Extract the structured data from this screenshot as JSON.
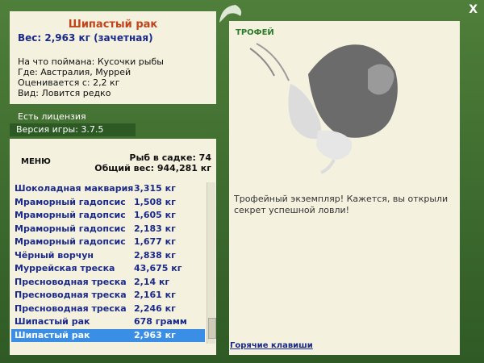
{
  "header": {
    "close_glyph": "X"
  },
  "fish": {
    "name": "Шипастый рак",
    "weight": "Вес: 2,963 кг (зачетная)",
    "caught_on": "На что поймана: Кусочки рыбы",
    "where": "Где: Австралия, Муррей",
    "valued_from": "Оценивается с: 2,2 кг",
    "rarity": "Вид: Ловится редко"
  },
  "license": "Есть лицензия",
  "version": "Версия игры: 3.7.5",
  "menu": "МЕНЮ",
  "stats": {
    "in_cage": "Рыб в садке: 74",
    "total": "Общий вес: 944,281 кг"
  },
  "catch_list": [
    {
      "name": "Шоколадная маквария",
      "weight": "3,315 кг"
    },
    {
      "name": "Мраморный гадопсис",
      "weight": "1,508 кг"
    },
    {
      "name": "Мраморный гадопсис",
      "weight": "1,605 кг"
    },
    {
      "name": "Мраморный гадопсис",
      "weight": "2,183 кг"
    },
    {
      "name": "Мраморный гадопсис",
      "weight": "1,677 кг"
    },
    {
      "name": "Чёрный ворчун",
      "weight": "2,838 кг"
    },
    {
      "name": "Муррейская треска",
      "weight": "43,675 кг"
    },
    {
      "name": "Пресноводная треска",
      "weight": "2,14 кг"
    },
    {
      "name": "Пресноводная треска",
      "weight": "2,161 кг"
    },
    {
      "name": "Пресноводная треска",
      "weight": "2,246 кг"
    },
    {
      "name": "Шипастый рак",
      "weight": "678 грамм"
    },
    {
      "name": "Шипастый рак",
      "weight": "2,963 кг",
      "selected": true
    }
  ],
  "trophy": {
    "label": "ТРОФЕЙ",
    "caption": "Трофейный экземпляр! Кажется, вы открыли секрет успешной ловли!"
  },
  "hotkeys": "Горячие клавиши",
  "colors": {
    "frame": "#3d6b2f",
    "panel": "#f4f1de",
    "selection": "#3a8ee6",
    "link": "#1b2a8a",
    "title": "#c0431a"
  }
}
